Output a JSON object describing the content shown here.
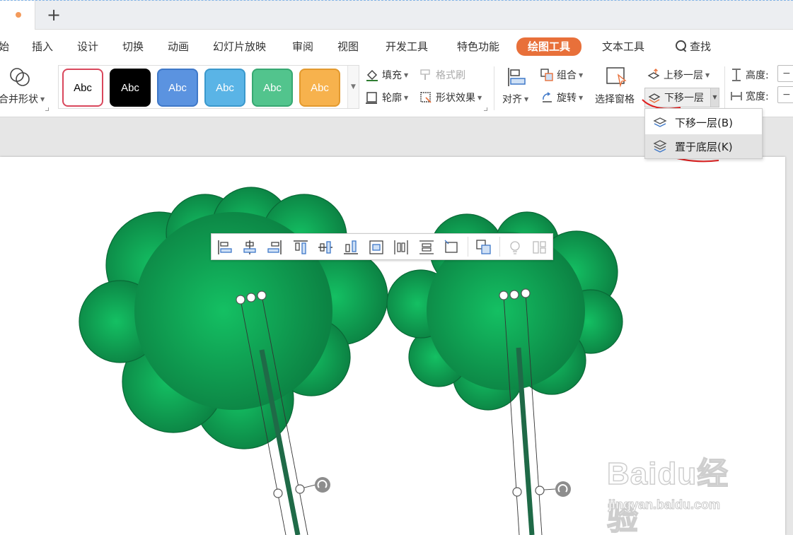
{
  "menu": {
    "items": [
      "始",
      "插入",
      "设计",
      "切换",
      "动画",
      "幻灯片放映",
      "审阅",
      "视图",
      "开发工具",
      "特色功能",
      "绘图工具",
      "文本工具"
    ],
    "active": "绘图工具",
    "search_label": "查找"
  },
  "ribbon": {
    "merge_shapes": "合并形状",
    "style_labels": [
      "Abc",
      "Abc",
      "Abc",
      "Abc",
      "Abc",
      "Abc"
    ],
    "fill": "填充",
    "format_painter": "格式刷",
    "outline": "轮廓",
    "shape_effects": "形状效果",
    "align": "对齐",
    "group": "组合",
    "rotate": "旋转",
    "selection_pane": "选择窗格",
    "bring_forward": "上移一层",
    "send_backward": "下移一层",
    "height_label": "高度:",
    "width_label": "宽度:",
    "height_value": "−",
    "width_value": "−"
  },
  "dropdown": {
    "send_backward": "下移一层(B)",
    "send_to_back": "置于底层(K)"
  },
  "watermark": {
    "brand": "Baidu经验",
    "url": "jingyan.baidu.com"
  },
  "colors": {
    "accent": "#e8703a",
    "tree_green": "#0e8a4a",
    "trunk": "#1f6a47",
    "annotation_red": "#e02020",
    "style_fills": [
      "#ffffff",
      "#000000",
      "#5b93e0",
      "#5ab4e6",
      "#52c48d",
      "#f7b24d"
    ],
    "style_borders": [
      "#d9475c",
      "#000000",
      "#3f78c8",
      "#3a98cc",
      "#37a872",
      "#e39a2f"
    ]
  },
  "icons": [
    "search-icon",
    "merge-shapes-icon",
    "fill-icon",
    "format-painter-icon",
    "outline-icon",
    "shape-effects-icon",
    "align-icon",
    "group-icon",
    "rotate-icon",
    "selection-pane-icon",
    "bring-forward-icon",
    "send-backward-icon",
    "send-to-back-icon",
    "height-icon",
    "width-icon",
    "rotate-handle-icon"
  ]
}
